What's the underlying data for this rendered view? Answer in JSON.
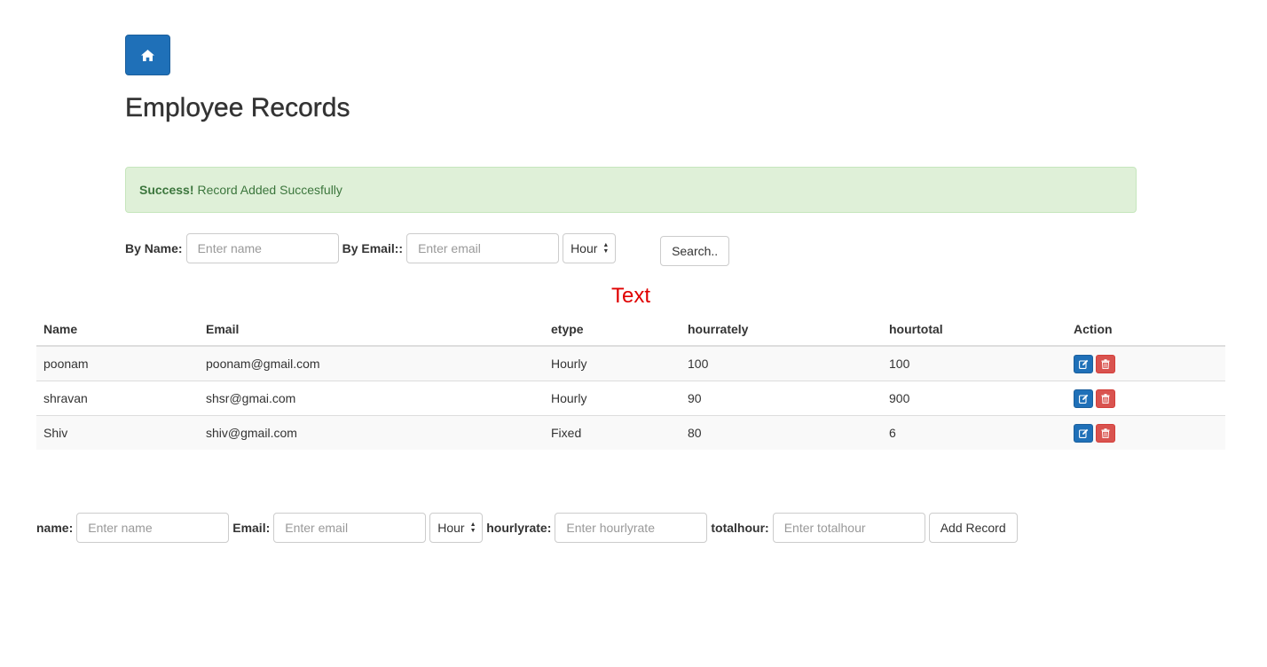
{
  "header": {
    "title": "Employee Records"
  },
  "alert": {
    "strong": "Success!",
    "message": "Record Added Succesfully"
  },
  "search": {
    "name_label": "By Name:",
    "name_placeholder": "Enter name",
    "email_label": "By Email::",
    "email_placeholder": "Enter email",
    "type_value": "Hour",
    "search_label": "Search.."
  },
  "text_heading": "Text",
  "table": {
    "headers": [
      "Name",
      "Email",
      "etype",
      "hourrately",
      "hourtotal",
      "Action"
    ],
    "rows": [
      [
        "poonam",
        "poonam@gmail.com",
        "Hourly",
        "100",
        "100"
      ],
      [
        "shravan",
        "shsr@gmai.com",
        "Hourly",
        "90",
        "900"
      ],
      [
        "Shiv",
        "shiv@gmail.com",
        "Fixed",
        "80",
        "6"
      ]
    ]
  },
  "add_form": {
    "name_label": "name:",
    "name_placeholder": "Enter name",
    "email_label": "Email:",
    "email_placeholder": "Enter email",
    "type_value": "Hour",
    "hourlyrate_label": "hourlyrate:",
    "hourlyrate_placeholder": "Enter hourlyrate",
    "totalhour_label": "totalhour:",
    "totalhour_placeholder": "Enter totalhour",
    "add_label": "Add Record"
  },
  "colors": {
    "primary": "#1f70b8",
    "danger": "#d9534f",
    "success_bg": "#dff0d8",
    "text_red": "#e00000"
  },
  "icons": {
    "home": "home-icon",
    "edit": "edit-icon",
    "delete": "trash-icon"
  }
}
